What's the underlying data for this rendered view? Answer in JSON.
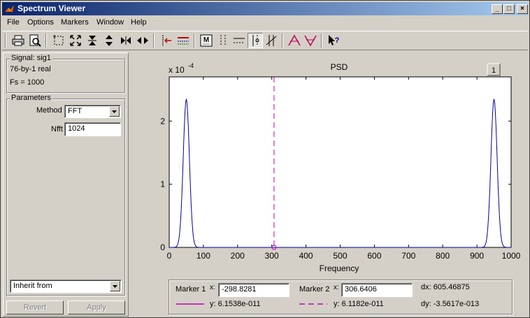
{
  "window": {
    "title": "Spectrum Viewer"
  },
  "titlebar_buttons": [
    "_",
    "□",
    "×"
  ],
  "menu": [
    "File",
    "Options",
    "Markers",
    "Window",
    "Help"
  ],
  "toolbar": {
    "icons": [
      "print-icon",
      "print-preview-icon",
      "zoom-box-icon",
      "full-view-icon",
      "vertical-zoom-in-icon",
      "vertical-zoom-out-icon",
      "horizontal-zoom-in-icon",
      "horizontal-zoom-out-icon",
      "set-markers-icon",
      "delete-markers-icon",
      "markers-button-icon",
      "vertical-markers-icon",
      "horizontal-markers-icon",
      "track-markers-icon",
      "slope-markers-icon",
      "peaks-icon",
      "valleys-icon",
      "whats-this-icon"
    ],
    "pressed": "track-markers-icon"
  },
  "signal": {
    "legend": "Signal: sig1",
    "size": "76-by-1 real",
    "fs": "Fs = 1000"
  },
  "parameters": {
    "legend": "Parameters",
    "method_label": "Method",
    "method_value": "FFT",
    "nfft_label": "Nfft",
    "nfft_value": "1024"
  },
  "inherit": {
    "value": "Inherit from"
  },
  "buttons": {
    "revert": "Revert",
    "apply": "Apply"
  },
  "plot": {
    "axis_tag": "1",
    "exponent_base": "x 10",
    "exponent_power": "-4"
  },
  "chart_data": {
    "type": "line",
    "title": "PSD",
    "xlabel": "Frequency",
    "ylabel": "",
    "xlim": [
      0,
      1000
    ],
    "ylim": [
      0,
      2.7
    ],
    "y_scale_note": "x 10^-4",
    "xticks": [
      0,
      100,
      200,
      300,
      400,
      500,
      600,
      700,
      800,
      900,
      1000
    ],
    "yticks": [
      0,
      1,
      2
    ],
    "series": [
      {
        "color": "#0000a0",
        "peaks": [
          {
            "x": 50,
            "y": 2.35,
            "half_width": 18
          },
          {
            "x": 950,
            "y": 2.35,
            "half_width": 18
          }
        ]
      }
    ],
    "markers": [
      {
        "x": 306.6406,
        "y": 0.0,
        "color": "#c000c0",
        "style": "dashed"
      }
    ]
  },
  "marker_panel": {
    "marker1_label": "Marker 1",
    "marker1_x_label": "x:",
    "marker1_x": "-298.8281",
    "marker1_y_label": "y: 6.1538e-011",
    "marker2_label": "Marker 2",
    "marker2_x_label": "x:",
    "marker2_x": "306.6406",
    "marker2_y_label": "y: 6.1182e-011",
    "dx": "dx: 605.46875",
    "dy": "dy: -3.5617e-013",
    "marker_color": "#c000c0"
  }
}
